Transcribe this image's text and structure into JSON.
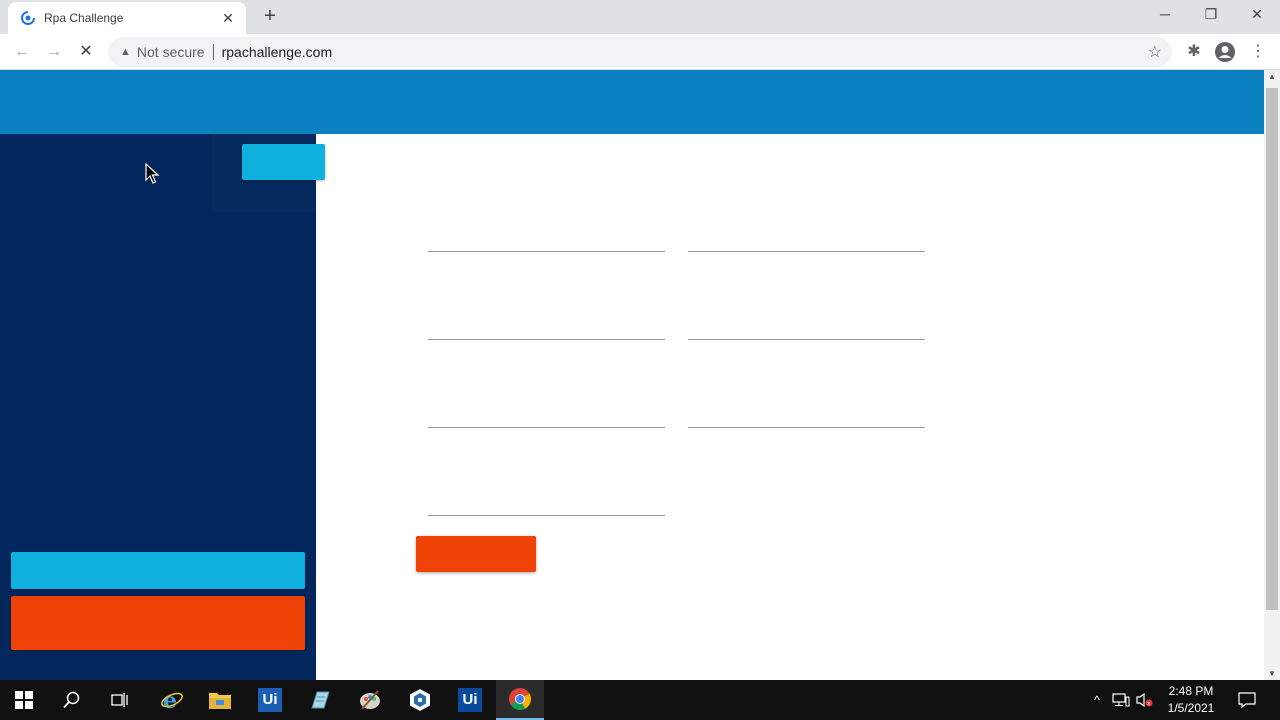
{
  "browser": {
    "tab_title": "Rpa Challenge",
    "tab_close": "✕",
    "new_tab": "+",
    "minimize": "─",
    "restore": "❐",
    "close": "✕",
    "security_label": "Not secure",
    "url": "rpachallenge.com",
    "back_icon": "←",
    "forward_icon": "→",
    "stop_icon": "✕",
    "star_icon": "☆",
    "extensions_icon": "✱",
    "menu_icon": "⋮"
  },
  "page": {
    "header_color": "#0b80c0",
    "sidebar_color": "#03275c",
    "accent_cyan": "#0eb1de",
    "accent_orange": "#ef4206"
  },
  "taskbar": {
    "apps": [
      "start-icon",
      "search-icon",
      "task-view-icon",
      "internet-explorer-icon",
      "file-explorer-icon",
      "uipath-studio-icon",
      "notepad-icon",
      "paint-icon",
      "app-icon",
      "uipath-assistant-icon",
      "chrome-icon"
    ],
    "ui_label_1": "Ui",
    "ui_label_2": "Ui",
    "tray_chevron": "^",
    "time": "2:48 PM",
    "date": "1/5/2021"
  }
}
